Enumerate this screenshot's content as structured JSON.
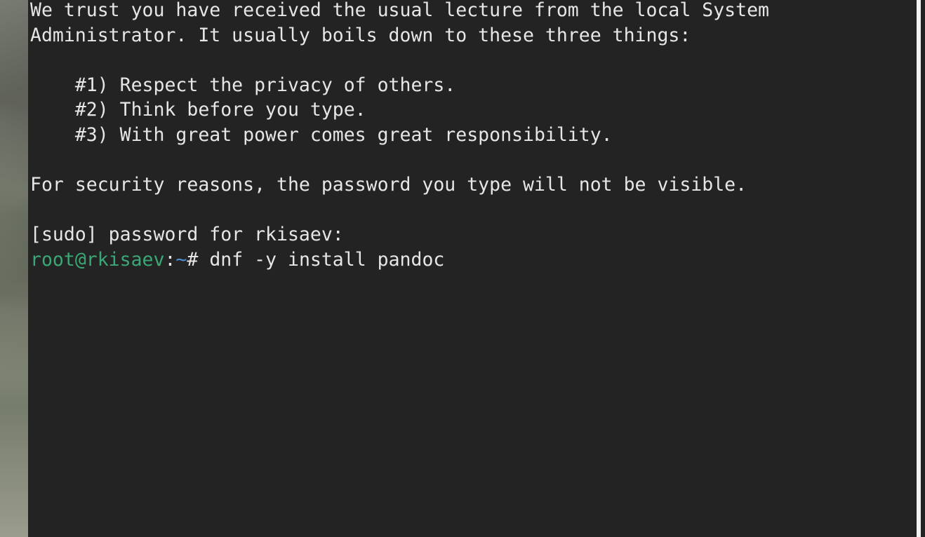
{
  "terminal": {
    "lines": [
      "We trust you have received the usual lecture from the local System",
      "Administrator. It usually boils down to these three things:",
      "",
      "    #1) Respect the privacy of others.",
      "    #2) Think before you type.",
      "    #3) With great power comes great responsibility.",
      "",
      "For security reasons, the password you type will not be visible.",
      "",
      "[sudo] password for rkisaev:"
    ],
    "prompt": {
      "user_host": "root@rkisaev",
      "separator": ":",
      "path": "~",
      "symbol": "#",
      "command": " dnf -y install pandoc"
    }
  },
  "colors": {
    "background": "#232323",
    "text": "#e6e6e6",
    "prompt_user": "#3aa876",
    "prompt_path": "#4f8fd6"
  }
}
